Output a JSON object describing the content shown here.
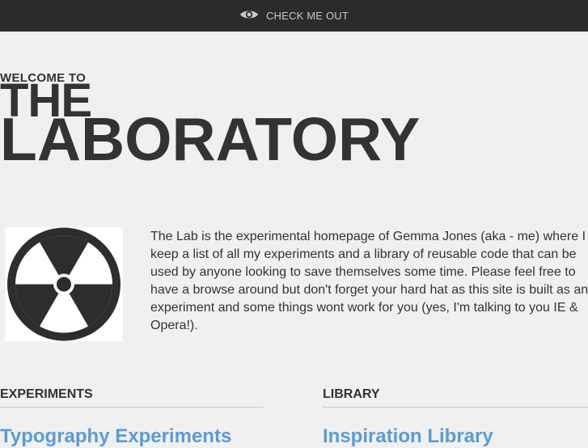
{
  "topbar": {
    "icon": "eye-icon",
    "link_label": "CHECK ME OUT"
  },
  "hero": {
    "welcome": "WELCOME TO",
    "the": "THE",
    "laboratory": "LABORATORY"
  },
  "intro": {
    "image_icon": "radiation-hazard-icon",
    "text": "The Lab is the experimental homepage of Gemma Jones (aka - me) where I keep a list of all my experiments and a library of reusable code that can be used by anyone looking to save themselves some time. Please feel free to have a browse around but don't forget your hard hat as this site is built as an experiment and some things wont work for you (yes, I'm talking to you IE & Opera!)."
  },
  "sections": {
    "experiments": {
      "heading": "EXPERIMENTS",
      "first_link": "Typography Experiments"
    },
    "library": {
      "heading": "LIBRARY",
      "first_link": "Inspiration Library"
    }
  },
  "colors": {
    "topbar_bg": "#2b2b2b",
    "page_bg": "#f0f0f0",
    "text": "#333333",
    "link": "#5b9bd5"
  }
}
